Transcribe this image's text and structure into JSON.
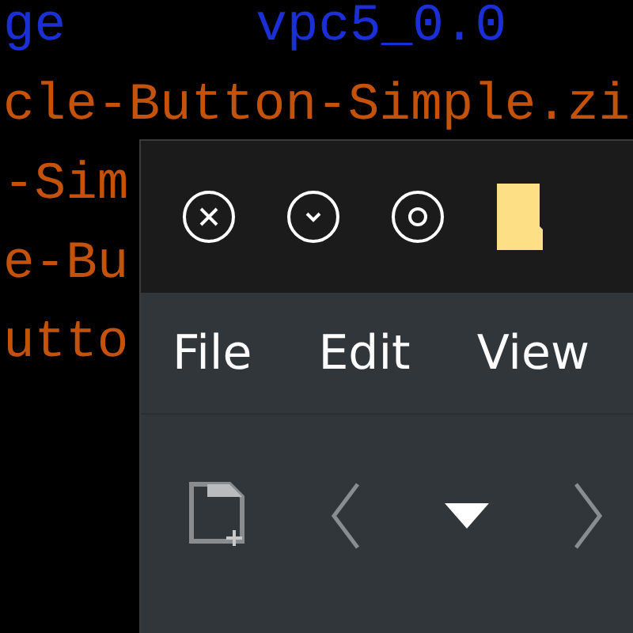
{
  "terminal": {
    "lines": [
      {
        "segments": [
          {
            "text": "ge",
            "color": "#1a2fd6"
          },
          {
            "text": "vpc5_0.0",
            "color": "#1a2fd6"
          }
        ]
      },
      {
        "segments": [
          {
            "text": "cle-Button-Simple.zi",
            "color": "#c4520a"
          }
        ]
      },
      {
        "segments": [
          {
            "text": "-Sim",
            "color": "#c4520a"
          }
        ]
      },
      {
        "segments": [
          {
            "text": "e-Bu",
            "color": "#c4520a"
          }
        ]
      },
      {
        "segments": [
          {
            "text": "utto",
            "color": "#c4520a"
          }
        ]
      }
    ]
  },
  "window": {
    "menu": [
      "File",
      "Edit",
      "View"
    ]
  }
}
